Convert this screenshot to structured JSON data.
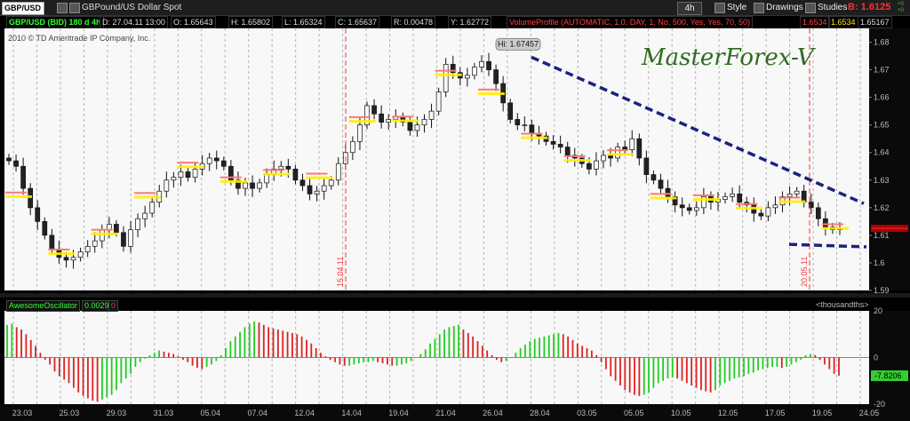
{
  "toolbar": {
    "symbol": "GBP/USD",
    "description": "GBPound/US Dollar Spot",
    "timeframe": "4h",
    "style_label": "Style",
    "drawings_label": "Drawings",
    "studies_label": "Studies",
    "bid_label": "B: 1.6125",
    "change_up": "+0",
    "change_down": "+0"
  },
  "infobar": {
    "title": "GBP/USD (BID) 180 d 4h",
    "date": "D: 27.04.11 13:00",
    "open": "O: 1.65643",
    "high": "H: 1.65802",
    "low": "L: 1.65324",
    "close": "C: 1.65637",
    "range": "R: 0.00478",
    "y": "Y: 1.62772",
    "volume_profile": "VolumeProfile (AUTOMATIC, 1.0, DAY, 1, No, 500, Yes, Yes, 70, 50)",
    "vp1": "1.6534",
    "vp2": "1.6534",
    "vp3": "1.65167"
  },
  "copyright": "2010 © TD Ameritrade IP Company, Inc.",
  "watermark": "MasterForex-V",
  "hi_label": "Hi: 1.67457",
  "oscillator": {
    "name": "AwesomeOscillator",
    "value": "0.0029",
    "value2": "0",
    "units": "<thousandths>",
    "last_value": "-7.8206"
  },
  "colors": {
    "up": "#22cc22",
    "down": "#dd2222",
    "trend": "#1a237e",
    "vline": "#ff3333",
    "poc": "#ffee00"
  },
  "chart_data": [
    {
      "type": "candlestick",
      "title": "GBP/USD (BID) 180 d 4h",
      "ylim": [
        1.59,
        1.685
      ],
      "yticks": [
        1.59,
        1.6,
        1.61,
        1.62,
        1.63,
        1.64,
        1.65,
        1.66,
        1.67,
        1.68
      ],
      "ytick_labels": [
        "1.59",
        "1.6",
        "1.61",
        "1.62",
        "1.63",
        "1.64",
        "1.65",
        "1.66",
        "1.67",
        "1.68"
      ],
      "current_price": 1.6125,
      "high_marker": 1.67457,
      "session_markers": [
        "15.04.11",
        "20.05.11"
      ],
      "xtick_labels": [
        "23.03",
        "25.03",
        "29.03",
        "31.03",
        "05.04",
        "07.04",
        "12.04",
        "14.04",
        "19.04",
        "21.04",
        "26.04",
        "28.04",
        "03.05",
        "05.05",
        "10.05",
        "12.05",
        "17.05",
        "19.05",
        "24.05"
      ],
      "close": [
        1.637,
        1.635,
        1.627,
        1.62,
        1.615,
        1.61,
        1.605,
        1.602,
        1.601,
        1.602,
        1.604,
        1.606,
        1.608,
        1.612,
        1.614,
        1.611,
        1.606,
        1.612,
        1.616,
        1.618,
        1.622,
        1.626,
        1.63,
        1.631,
        1.633,
        1.631,
        1.634,
        1.636,
        1.638,
        1.637,
        1.635,
        1.63,
        1.627,
        1.629,
        1.627,
        1.629,
        1.632,
        1.634,
        1.635,
        1.634,
        1.63,
        1.628,
        1.625,
        1.626,
        1.628,
        1.63,
        1.636,
        1.64,
        1.644,
        1.65,
        1.657,
        1.654,
        1.651,
        1.652,
        1.653,
        1.651,
        1.648,
        1.65,
        1.652,
        1.655,
        1.662,
        1.672,
        1.669,
        1.667,
        1.668,
        1.671,
        1.673,
        1.67,
        1.665,
        1.658,
        1.652,
        1.65,
        1.65,
        1.647,
        1.646,
        1.644,
        1.643,
        1.642,
        1.639,
        1.638,
        1.636,
        1.634,
        1.637,
        1.639,
        1.638,
        1.642,
        1.641,
        1.645,
        1.638,
        1.632,
        1.63,
        1.627,
        1.624,
        1.621,
        1.62,
        1.619,
        1.62,
        1.624,
        1.622,
        1.623,
        1.624,
        1.625,
        1.622,
        1.621,
        1.618,
        1.617,
        1.62,
        1.621,
        1.624,
        1.625,
        1.626,
        1.622,
        1.62,
        1.616,
        1.613,
        1.612,
        1.6125
      ]
    },
    {
      "type": "bar",
      "title": "AwesomeOscillator",
      "ylabel": "<thousandths>",
      "ylim": [
        -20,
        20
      ],
      "yticks": [
        20,
        0,
        -20
      ],
      "ytick_labels": [
        "20",
        "0",
        "-20"
      ],
      "series": [
        {
          "name": "AwesomeOscillator",
          "values": [
            14,
            14.5,
            13,
            12,
            10,
            7.5,
            5,
            2,
            -1,
            -3,
            -6,
            -8,
            -9.5,
            -11,
            -13,
            -15,
            -16.5,
            -17.5,
            -18.5,
            -19,
            -18,
            -17,
            -16,
            -14,
            -11,
            -9,
            -7,
            -4,
            -2,
            -0.5,
            1,
            2,
            3,
            2.5,
            2,
            1.5,
            0.5,
            -1,
            -2,
            -3.5,
            -4.5,
            -5,
            -4,
            -3,
            -1.5,
            1,
            4,
            7,
            9,
            11,
            13,
            14.5,
            15.5,
            15,
            14,
            13,
            12.5,
            12,
            11.5,
            11,
            10.5,
            10,
            9,
            7.5,
            6,
            4,
            2,
            0.5,
            -1,
            -2,
            -3,
            -3.5,
            -3.5,
            -3,
            -2.5,
            -2,
            -2,
            -1.5,
            -2,
            -2.5,
            -3,
            -3.5,
            -3.5,
            -3,
            -2.5,
            -1.5,
            0,
            1.5,
            3.5,
            6,
            8,
            10,
            12,
            13,
            13.5,
            14,
            12,
            10.5,
            9,
            7,
            5,
            3,
            1,
            -1,
            -2,
            -1.5,
            0,
            2,
            4,
            5.5,
            7,
            8,
            8.5,
            9,
            9.5,
            10,
            10.5,
            10,
            9,
            7.5,
            6,
            5,
            4,
            3,
            1,
            -2,
            -5,
            -8,
            -10,
            -12,
            -14,
            -15,
            -16,
            -16.5,
            -16,
            -15,
            -13,
            -11,
            -10,
            -9,
            -8.5,
            -9,
            -10,
            -11,
            -12,
            -13,
            -14,
            -14.5,
            -15,
            -14,
            -12,
            -11,
            -10,
            -9,
            -8.5,
            -8,
            -7,
            -6.5,
            -5.5,
            -5,
            -4.5,
            -4,
            -4,
            -4.5,
            -4,
            -3,
            -2,
            -1,
            1,
            1.5,
            1,
            -1,
            -3,
            -5,
            -7,
            -7.8206
          ]
        }
      ]
    }
  ]
}
